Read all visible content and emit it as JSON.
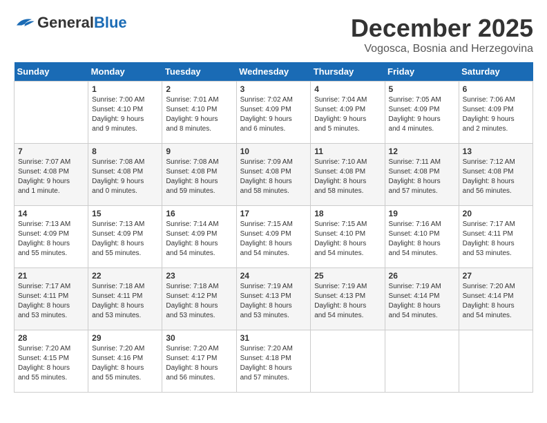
{
  "header": {
    "logo": {
      "general": "General",
      "blue": "Blue"
    },
    "month": "December 2025",
    "location": "Vogosca, Bosnia and Herzegovina"
  },
  "weekdays": [
    "Sunday",
    "Monday",
    "Tuesday",
    "Wednesday",
    "Thursday",
    "Friday",
    "Saturday"
  ],
  "weeks": [
    [
      {
        "day": "",
        "info": ""
      },
      {
        "day": "1",
        "info": "Sunrise: 7:00 AM\nSunset: 4:10 PM\nDaylight: 9 hours\nand 9 minutes."
      },
      {
        "day": "2",
        "info": "Sunrise: 7:01 AM\nSunset: 4:10 PM\nDaylight: 9 hours\nand 8 minutes."
      },
      {
        "day": "3",
        "info": "Sunrise: 7:02 AM\nSunset: 4:09 PM\nDaylight: 9 hours\nand 6 minutes."
      },
      {
        "day": "4",
        "info": "Sunrise: 7:04 AM\nSunset: 4:09 PM\nDaylight: 9 hours\nand 5 minutes."
      },
      {
        "day": "5",
        "info": "Sunrise: 7:05 AM\nSunset: 4:09 PM\nDaylight: 9 hours\nand 4 minutes."
      },
      {
        "day": "6",
        "info": "Sunrise: 7:06 AM\nSunset: 4:09 PM\nDaylight: 9 hours\nand 2 minutes."
      }
    ],
    [
      {
        "day": "7",
        "info": "Sunrise: 7:07 AM\nSunset: 4:08 PM\nDaylight: 9 hours\nand 1 minute."
      },
      {
        "day": "8",
        "info": "Sunrise: 7:08 AM\nSunset: 4:08 PM\nDaylight: 9 hours\nand 0 minutes."
      },
      {
        "day": "9",
        "info": "Sunrise: 7:08 AM\nSunset: 4:08 PM\nDaylight: 8 hours\nand 59 minutes."
      },
      {
        "day": "10",
        "info": "Sunrise: 7:09 AM\nSunset: 4:08 PM\nDaylight: 8 hours\nand 58 minutes."
      },
      {
        "day": "11",
        "info": "Sunrise: 7:10 AM\nSunset: 4:08 PM\nDaylight: 8 hours\nand 58 minutes."
      },
      {
        "day": "12",
        "info": "Sunrise: 7:11 AM\nSunset: 4:08 PM\nDaylight: 8 hours\nand 57 minutes."
      },
      {
        "day": "13",
        "info": "Sunrise: 7:12 AM\nSunset: 4:08 PM\nDaylight: 8 hours\nand 56 minutes."
      }
    ],
    [
      {
        "day": "14",
        "info": "Sunrise: 7:13 AM\nSunset: 4:09 PM\nDaylight: 8 hours\nand 55 minutes."
      },
      {
        "day": "15",
        "info": "Sunrise: 7:13 AM\nSunset: 4:09 PM\nDaylight: 8 hours\nand 55 minutes."
      },
      {
        "day": "16",
        "info": "Sunrise: 7:14 AM\nSunset: 4:09 PM\nDaylight: 8 hours\nand 54 minutes."
      },
      {
        "day": "17",
        "info": "Sunrise: 7:15 AM\nSunset: 4:09 PM\nDaylight: 8 hours\nand 54 minutes."
      },
      {
        "day": "18",
        "info": "Sunrise: 7:15 AM\nSunset: 4:10 PM\nDaylight: 8 hours\nand 54 minutes."
      },
      {
        "day": "19",
        "info": "Sunrise: 7:16 AM\nSunset: 4:10 PM\nDaylight: 8 hours\nand 54 minutes."
      },
      {
        "day": "20",
        "info": "Sunrise: 7:17 AM\nSunset: 4:11 PM\nDaylight: 8 hours\nand 53 minutes."
      }
    ],
    [
      {
        "day": "21",
        "info": "Sunrise: 7:17 AM\nSunset: 4:11 PM\nDaylight: 8 hours\nand 53 minutes."
      },
      {
        "day": "22",
        "info": "Sunrise: 7:18 AM\nSunset: 4:11 PM\nDaylight: 8 hours\nand 53 minutes."
      },
      {
        "day": "23",
        "info": "Sunrise: 7:18 AM\nSunset: 4:12 PM\nDaylight: 8 hours\nand 53 minutes."
      },
      {
        "day": "24",
        "info": "Sunrise: 7:19 AM\nSunset: 4:13 PM\nDaylight: 8 hours\nand 53 minutes."
      },
      {
        "day": "25",
        "info": "Sunrise: 7:19 AM\nSunset: 4:13 PM\nDaylight: 8 hours\nand 54 minutes."
      },
      {
        "day": "26",
        "info": "Sunrise: 7:19 AM\nSunset: 4:14 PM\nDaylight: 8 hours\nand 54 minutes."
      },
      {
        "day": "27",
        "info": "Sunrise: 7:20 AM\nSunset: 4:14 PM\nDaylight: 8 hours\nand 54 minutes."
      }
    ],
    [
      {
        "day": "28",
        "info": "Sunrise: 7:20 AM\nSunset: 4:15 PM\nDaylight: 8 hours\nand 55 minutes."
      },
      {
        "day": "29",
        "info": "Sunrise: 7:20 AM\nSunset: 4:16 PM\nDaylight: 8 hours\nand 55 minutes."
      },
      {
        "day": "30",
        "info": "Sunrise: 7:20 AM\nSunset: 4:17 PM\nDaylight: 8 hours\nand 56 minutes."
      },
      {
        "day": "31",
        "info": "Sunrise: 7:20 AM\nSunset: 4:18 PM\nDaylight: 8 hours\nand 57 minutes."
      },
      {
        "day": "",
        "info": ""
      },
      {
        "day": "",
        "info": ""
      },
      {
        "day": "",
        "info": ""
      }
    ]
  ]
}
